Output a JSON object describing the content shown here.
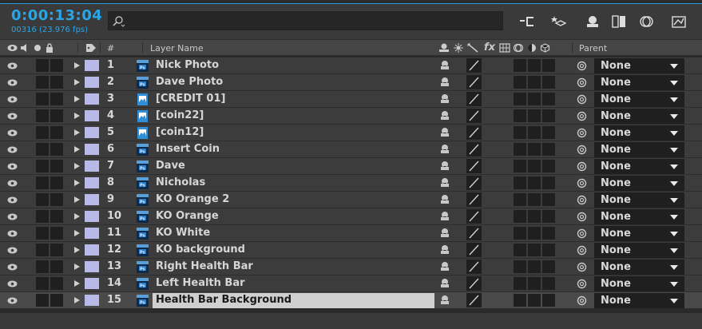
{
  "toolbar": {
    "timecode": "0:00:13:04",
    "frames": "00316 (23.976 fps)",
    "search_placeholder": ""
  },
  "header": {
    "layer_name": "Layer Name",
    "number": "#",
    "parent": "Parent"
  },
  "layers": [
    {
      "num": "1",
      "name": "Nick Photo",
      "type": "psd",
      "parent": "None"
    },
    {
      "num": "2",
      "name": "Dave Photo",
      "type": "psd",
      "parent": "None"
    },
    {
      "num": "3",
      "name": "[CREDIT 01]",
      "type": "img",
      "parent": "None"
    },
    {
      "num": "4",
      "name": "[coin22]",
      "type": "img",
      "parent": "None"
    },
    {
      "num": "5",
      "name": "[coin12]",
      "type": "img",
      "parent": "None"
    },
    {
      "num": "6",
      "name": "Insert Coin",
      "type": "psd",
      "parent": "None"
    },
    {
      "num": "7",
      "name": "Dave",
      "type": "psd",
      "parent": "None"
    },
    {
      "num": "8",
      "name": "Nicholas",
      "type": "psd",
      "parent": "None"
    },
    {
      "num": "9",
      "name": "KO Orange 2",
      "type": "psd",
      "parent": "None"
    },
    {
      "num": "10",
      "name": "KO Orange",
      "type": "psd",
      "parent": "None"
    },
    {
      "num": "11",
      "name": "KO White",
      "type": "psd",
      "parent": "None"
    },
    {
      "num": "12",
      "name": "KO background",
      "type": "psd",
      "parent": "None"
    },
    {
      "num": "13",
      "name": "Right Health Bar",
      "type": "psd",
      "parent": "None"
    },
    {
      "num": "14",
      "name": "Left Health Bar",
      "type": "psd",
      "parent": "None"
    },
    {
      "num": "15",
      "name": "Health Bar Background",
      "type": "psd",
      "parent": "None",
      "selected": true
    }
  ],
  "colors": {
    "accent": "#2aa6e8",
    "label_swatch": "#b9b9e8",
    "row_bg": "#3c3c3c"
  },
  "icons": {
    "psd": "photoshop-file-icon",
    "img": "image-file-icon"
  }
}
